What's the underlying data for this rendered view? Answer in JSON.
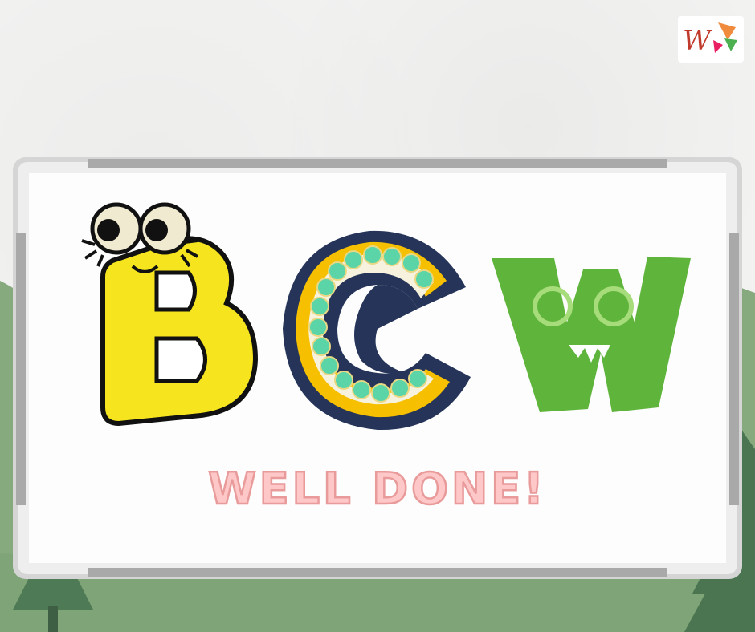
{
  "logo": {
    "text": "W",
    "icon": "brand-logo-icon"
  },
  "board": {
    "letters": [
      {
        "char": "B",
        "color": "#f6e51e"
      },
      {
        "char": "C",
        "color": "#253458"
      },
      {
        "char": "W",
        "color": "#5fb43c"
      }
    ],
    "message": "WELL DONE!"
  },
  "colors": {
    "background": "#f2f2f1",
    "hills": "#7fa477",
    "message_fill": "#ffc8c8",
    "message_stroke": "#e99a9a",
    "frame": "#b8b8b8"
  }
}
